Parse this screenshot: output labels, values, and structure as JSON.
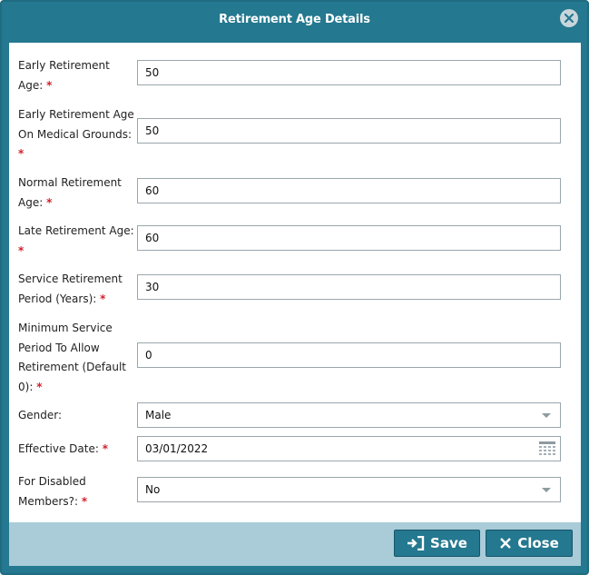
{
  "dialog": {
    "title": "Retirement Age Details"
  },
  "fields": [
    {
      "label": "Early Retirement Age:",
      "required": "*",
      "value": "50"
    },
    {
      "label": "Early Retirement Age On Medical Grounds:",
      "required": "*",
      "value": "50"
    },
    {
      "label": "Normal Retirement Age:",
      "required": "*",
      "value": "60"
    },
    {
      "label": "Late Retirement Age:",
      "required": "*",
      "value": "60"
    },
    {
      "label": "Service Retirement Period (Years):",
      "required": "*",
      "value": "30"
    },
    {
      "label": "Minimum Service Period To Allow Retirement (Default 0):",
      "required": "*",
      "value": "0"
    },
    {
      "label": "Gender:",
      "value": "Male"
    },
    {
      "label": "Effective Date:",
      "required": "*",
      "value": "03/01/2022"
    },
    {
      "label": "For Disabled Members?:",
      "required": "*",
      "value": "No"
    }
  ],
  "buttons": {
    "save": "Save",
    "close": "Close"
  },
  "icons": {
    "close": "close-circle-icon",
    "calendar": "calendar-icon",
    "save": "sign-in-icon",
    "close_btn": "x-icon"
  },
  "colors": {
    "header": "#24788f",
    "footer": "#a9ccd8",
    "required": "#d4202c"
  }
}
